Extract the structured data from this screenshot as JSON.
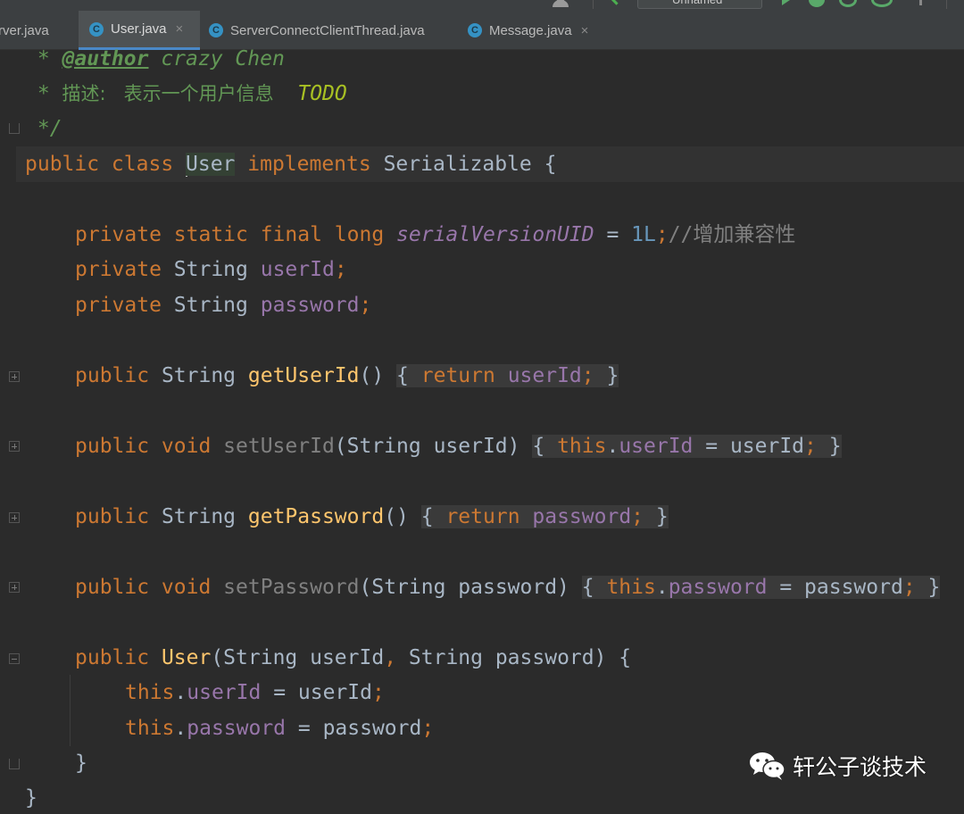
{
  "toolbar": {
    "run_config": "Unnamed"
  },
  "tabs": [
    {
      "label": "rver.java",
      "icon": "C",
      "active": false,
      "closable": false
    },
    {
      "label": "User.java",
      "icon": "C",
      "active": true,
      "closable": true
    },
    {
      "label": "ServerConnectClientThread.java",
      "icon": "C",
      "active": false,
      "closable": false
    },
    {
      "label": "Message.java",
      "icon": "C",
      "active": false,
      "closable": true
    }
  ],
  "close_glyph": "×",
  "code": {
    "doc_author_prefix": " * ",
    "doc_author_tag": "@author",
    "doc_author_name": " crazy Chen",
    "doc_desc_prefix": " * ",
    "doc_desc_text": "描述:   表示一个用户信息    ",
    "doc_desc_todo": "TODO",
    "doc_end": " */",
    "class_kw": "public class ",
    "class_name": "User",
    "class_impl_kw": " implements ",
    "class_iface": "Serializable {",
    "svu_mods": "private static final long ",
    "svu_name": "serialVersionUID",
    "svu_eq": " = ",
    "svu_val": "1L",
    "svu_semi": ";",
    "svu_comment": "//增加兼容性",
    "f1_mod": "private ",
    "f1_type": "String ",
    "f1_name": "userId",
    "f1_semi": ";",
    "f2_mod": "private ",
    "f2_type": "String ",
    "f2_name": "password",
    "f2_semi": ";",
    "m1_mod": "public ",
    "m1_type": "String ",
    "m1_name": "getUserId",
    "m1_parens": "() ",
    "m1_open": "{ ",
    "m1_ret": "return ",
    "m1_field": "userId",
    "m1_semi": ";",
    "m1_close": " }",
    "m2_mod": "public void ",
    "m2_name": "setUserId",
    "m2_params": "(String userId) ",
    "m2_open": "{ ",
    "m2_this": "this",
    "m2_dot": ".",
    "m2_field": "userId",
    "m2_assign": " = userId",
    "m2_semi": ";",
    "m2_close": " }",
    "m3_mod": "public ",
    "m3_type": "String ",
    "m3_name": "getPassword",
    "m3_parens": "() ",
    "m3_open": "{ ",
    "m3_ret": "return ",
    "m3_field": "password",
    "m3_semi": ";",
    "m3_close": " }",
    "m4_mod": "public void ",
    "m4_name": "setPassword",
    "m4_params": "(String password) ",
    "m4_open": "{ ",
    "m4_this": "this",
    "m4_dot": ".",
    "m4_field": "password",
    "m4_assign": " = password",
    "m4_semi": ";",
    "m4_close": " }",
    "ctor_mod": "public ",
    "ctor_name": "User",
    "ctor_params_a": "(String userId",
    "ctor_comma": ",",
    "ctor_params_b": " String password) {",
    "ctor_l1_this": "this",
    "ctor_l1_dot": ".",
    "ctor_l1_field": "userId",
    "ctor_l1_assign": " = userId",
    "ctor_l1_semi": ";",
    "ctor_l2_this": "this",
    "ctor_l2_dot": ".",
    "ctor_l2_field": "password",
    "ctor_l2_assign": " = password",
    "ctor_l2_semi": ";",
    "ctor_end": "}",
    "class_end": "}"
  },
  "watermark": {
    "text": "轩公子谈技术",
    "icon": "wechat-logo-icon"
  },
  "colors": {
    "keyword": "#cc7832",
    "field": "#9876aa",
    "number": "#6897bb",
    "comment": "#808080",
    "doc": "#629755",
    "todo": "#a8c023",
    "method": "#ffc66d",
    "text": "#a9b7c6",
    "tab_accent": "#4a88c7",
    "background": "#2b2b2b"
  }
}
